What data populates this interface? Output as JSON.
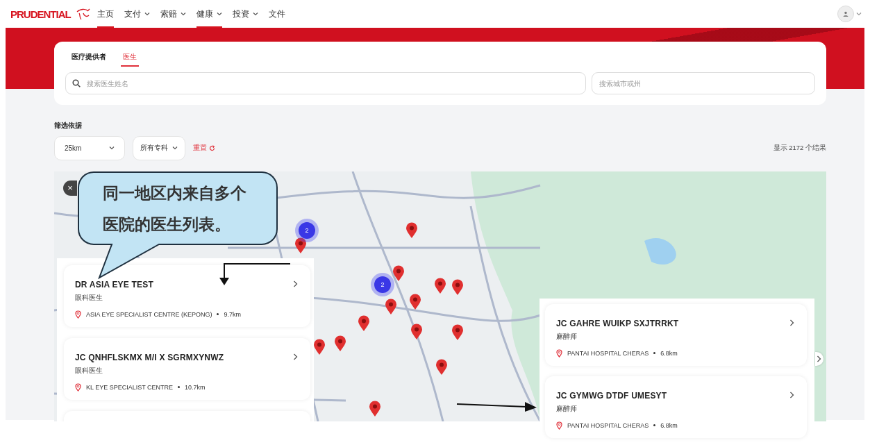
{
  "header": {
    "logo": "PRUDENTIAL",
    "nav": [
      {
        "label": "主页",
        "selected": true,
        "dropdown": false
      },
      {
        "label": "支付",
        "selected": false,
        "dropdown": true
      },
      {
        "label": "索赔",
        "selected": false,
        "dropdown": true
      },
      {
        "label": "健康",
        "selected": true,
        "dropdown": true
      },
      {
        "label": "投资",
        "selected": false,
        "dropdown": true
      },
      {
        "label": "文件",
        "selected": false,
        "dropdown": false
      }
    ]
  },
  "search": {
    "tabs": [
      {
        "label": "医疗提供者",
        "selected": false
      },
      {
        "label": "医生",
        "selected": true
      }
    ],
    "name_field": {
      "placeholder": "搜索医生姓名"
    },
    "location_field": {
      "placeholder": "搜索城市或州"
    }
  },
  "filters": {
    "title": "筛选依据",
    "distance": "25km",
    "specialty": "所有专科",
    "reset": "重置",
    "results": "显示 2172 个结果"
  },
  "map": {
    "close": "×",
    "clusters": [
      {
        "count": "2"
      },
      {
        "count": "2"
      }
    ],
    "left_list": [
      {
        "name": "DR ASIA EYE TEST",
        "specialty": "眼科医生",
        "hospital": "ASIA EYE SPECIALIST CENTRE (KEPONG)",
        "distance": "9.7km"
      },
      {
        "name": "JC QNHFLSKMX M/I X SGRMXYNWZ",
        "specialty": "眼科医生",
        "hospital": "KL EYE SPECIALIST CENTRE",
        "distance": "10.7km"
      }
    ],
    "right_list": [
      {
        "name": "JC GAHRE WUIKP SXJTRRKT",
        "specialty": "麻醉师",
        "hospital": "PANTAI HOSPITAL CHERAS",
        "distance": "6.8km"
      },
      {
        "name": "JC GYMWG DTDF UMESYT",
        "specialty": "麻醉师",
        "hospital": "PANTAI HOSPITAL CHERAS",
        "distance": "6.8km"
      }
    ]
  },
  "annotation": {
    "callout": "同一地区内来自多个医院的医生列表。"
  }
}
